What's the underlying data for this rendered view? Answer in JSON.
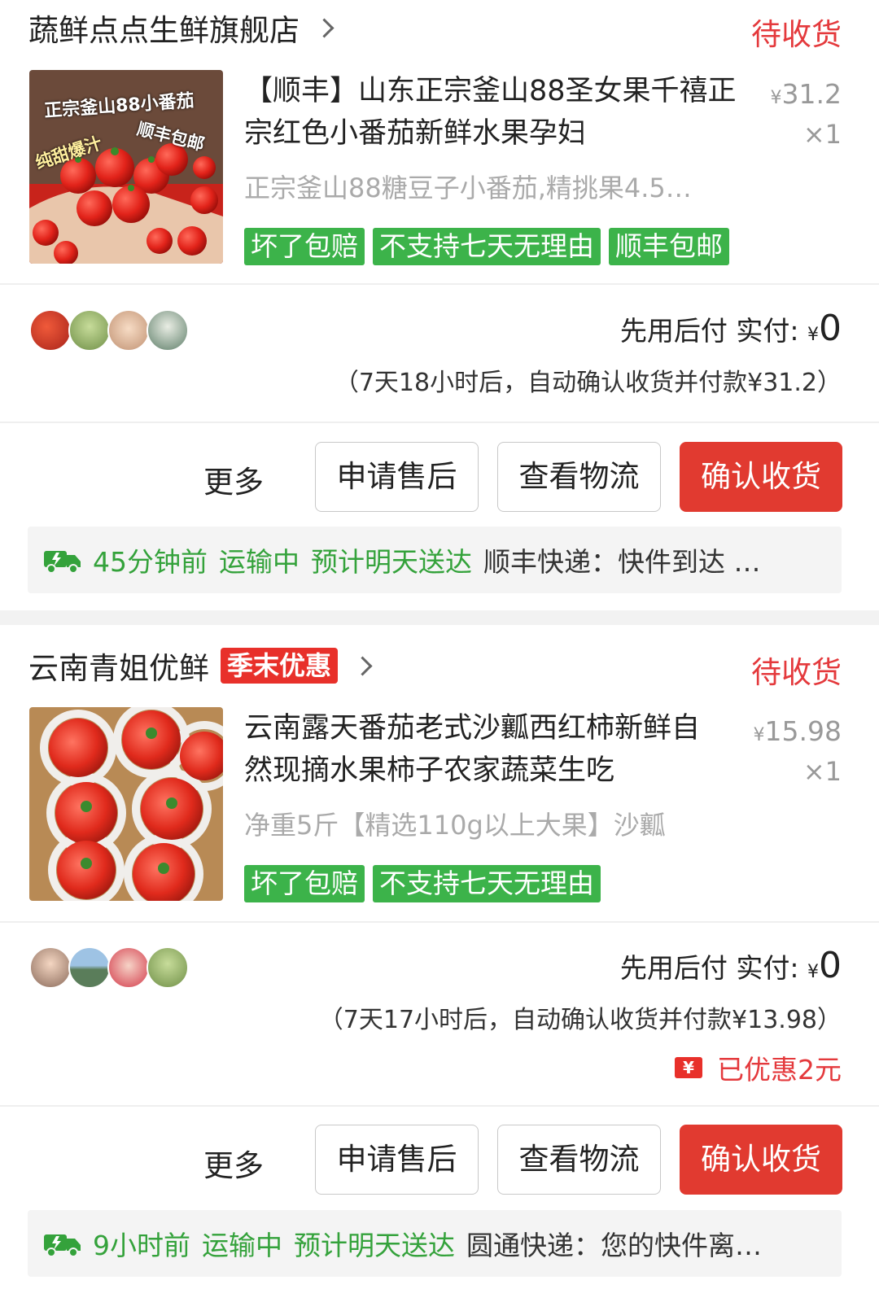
{
  "orders": [
    {
      "shop_name": "蔬鲜点点生鲜旗舰店",
      "promo_tag": "",
      "status": "待收货",
      "product_title": "【顺丰】山东正宗釜山88圣女果千禧正宗红色小番茄新鲜水果孕妇",
      "price_symbol": "¥",
      "price": "31.2",
      "quantity": "×1",
      "spec": "正宗釜山88糖豆子小番茄,精挑果4.5…",
      "image_text": [
        "正宗釜山88小番茄",
        "顺丰包邮",
        "纯甜爆汁"
      ],
      "tags": [
        "坏了包赔",
        "不支持七天无理由",
        "顺丰包邮"
      ],
      "pay_label": "先用后付 实付:",
      "pay_symbol": "¥",
      "pay_amount": "0",
      "auto_confirm": "（7天18小时后，自动确认收货并付款¥31.2）",
      "saved": "",
      "buttons": {
        "more": "更多",
        "after_sale": "申请售后",
        "logistics": "查看物流",
        "confirm": "确认收货"
      },
      "logistics": {
        "time": "45分钟前",
        "state": "运输中",
        "eta": "预计明天送达",
        "detail": "顺丰快递：快件到达 …"
      }
    },
    {
      "shop_name": "云南青姐优鲜",
      "promo_tag": "季末优惠",
      "status": "待收货",
      "product_title": "云南露天番茄老式沙瓤西红柿新鲜自然现摘水果柿子农家蔬菜生吃",
      "price_symbol": "¥",
      "price": "15.98",
      "quantity": "×1",
      "spec": "净重5斤【精选110g以上大果】沙瓤",
      "tags": [
        "坏了包赔",
        "不支持七天无理由"
      ],
      "pay_label": "先用后付 实付:",
      "pay_symbol": "¥",
      "pay_amount": "0",
      "auto_confirm": "（7天17小时后，自动确认收货并付款¥13.98）",
      "coupon_icon": "¥",
      "saved": "已优惠2元",
      "buttons": {
        "more": "更多",
        "after_sale": "申请售后",
        "logistics": "查看物流",
        "confirm": "确认收货"
      },
      "logistics": {
        "time": "9小时前",
        "state": "运输中",
        "eta": "预计明天送达",
        "detail": "圆通快递：您的快件离…"
      }
    }
  ],
  "colors": {
    "accent_red": "#e13a30",
    "tag_green": "#3cb34a",
    "logistics_green": "#34a23b"
  },
  "icons": [
    "chevron-right-icon",
    "truck-icon",
    "coupon-icon"
  ]
}
